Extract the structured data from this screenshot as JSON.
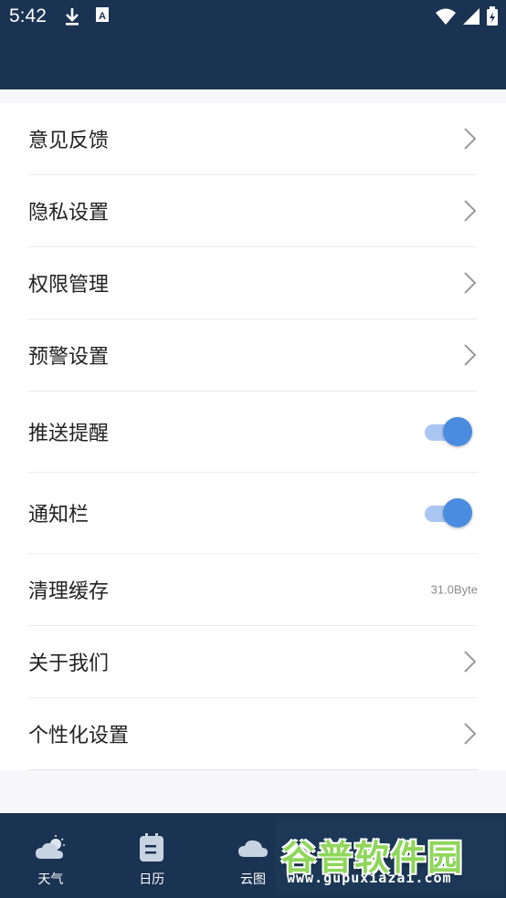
{
  "status_bar": {
    "time": "5:42",
    "left_icons": [
      "download-icon",
      "text-a-icon"
    ],
    "right_icons": [
      "wifi-icon",
      "signal-icon",
      "battery-icon"
    ]
  },
  "settings": {
    "items": [
      {
        "label": "意见反馈",
        "control": "chevron"
      },
      {
        "label": "隐私设置",
        "control": "chevron"
      },
      {
        "label": "权限管理",
        "control": "chevron"
      },
      {
        "label": "预警设置",
        "control": "chevron"
      },
      {
        "label": "推送提醒",
        "control": "toggle",
        "on": true
      },
      {
        "label": "通知栏",
        "control": "toggle",
        "on": true
      },
      {
        "label": "清理缓存",
        "control": "value",
        "value": "31.0Byte"
      },
      {
        "label": "关于我们",
        "control": "chevron"
      },
      {
        "label": "个性化设置",
        "control": "chevron"
      }
    ]
  },
  "bottom_nav": {
    "items": [
      {
        "label": "天气",
        "icon": "weather-icon"
      },
      {
        "label": "日历",
        "icon": "calendar-icon"
      },
      {
        "label": "云图",
        "icon": "cloud-icon"
      },
      {
        "label": "",
        "icon": "unknown-icon"
      },
      {
        "label": "",
        "icon": "unknown-icon"
      }
    ]
  },
  "watermark": {
    "main": "谷普软件园",
    "sub": "www.gupuxiazai.com"
  },
  "colors": {
    "header": "#1b3352",
    "toggle_on": "#4a8ce0",
    "toggle_track": "#a9c7f2",
    "background": "#f7f7f9"
  }
}
